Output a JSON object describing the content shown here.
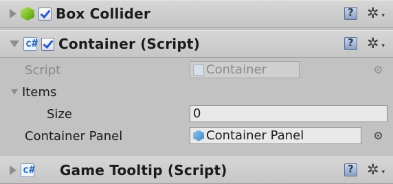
{
  "components": {
    "box_collider": {
      "title": "Box Collider",
      "enabled": true,
      "icon": "cube-icon"
    },
    "container_script": {
      "title": "Container (Script)",
      "enabled": true,
      "icon": "script-icon"
    },
    "game_tooltip": {
      "title": "Game Tooltip (Script)",
      "icon": "script-icon"
    }
  },
  "container_fields": {
    "script_label": "Script",
    "script_value": "Container",
    "items_label": "Items",
    "size_label": "Size",
    "size_value": "0",
    "panel_label": "Container Panel",
    "panel_value": "Container Panel"
  },
  "icons": {
    "help": "?",
    "gear": "✲",
    "gear_caret": "▾",
    "script_glyph": "c#"
  }
}
